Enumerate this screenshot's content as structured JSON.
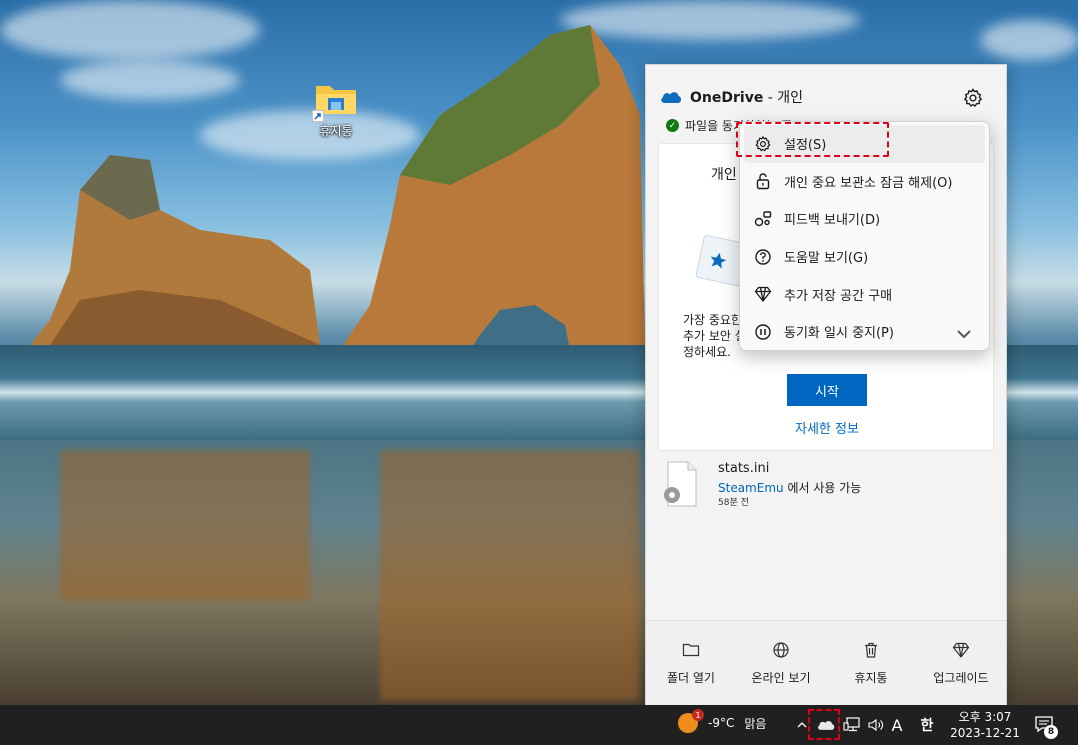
{
  "desktop": {
    "icons": [
      {
        "label": "휴지통",
        "icon": "folder-icon"
      }
    ]
  },
  "onedrive": {
    "title": "OneDrive",
    "title_suffix": " - 개인",
    "sync_status": "파일을 동기화하는 중",
    "card": {
      "title": "개인",
      "description": "가장 중요한 추가 보안 설정하세요.",
      "start_button": "시작",
      "more_link": "자세한 정보"
    },
    "file": {
      "name": "stats.ini",
      "location_link": "SteamEmu",
      "location_suffix": " 에서 사용 가능",
      "time": "58분 전"
    },
    "footer": [
      {
        "label": "폴더 열기",
        "icon": "folder-icon"
      },
      {
        "label": "온라인 보기",
        "icon": "globe-icon"
      },
      {
        "label": "휴지통",
        "icon": "trash-icon"
      },
      {
        "label": "업그레이드",
        "icon": "diamond-icon"
      }
    ]
  },
  "menu": {
    "items": [
      {
        "label": "설정(S)",
        "icon": "gear-icon"
      },
      {
        "label": "개인 중요 보관소 잠금 해제(O)",
        "icon": "unlock-icon"
      },
      {
        "label": "피드백 보내기(D)",
        "icon": "feedback-icon"
      },
      {
        "label": "도움말 보기(G)",
        "icon": "help-icon"
      },
      {
        "label": "추가 저장 공간 구매",
        "icon": "diamond-icon"
      },
      {
        "label": "동기화 일시 중지(P)",
        "icon": "pause-icon"
      }
    ]
  },
  "taskbar": {
    "weather_temp": "-9°C",
    "weather_desc": "맑음",
    "weather_badge": "1",
    "ime_letter": "A",
    "ime_lang": "한",
    "time": "오후 3:07",
    "date": "2023-12-21",
    "notification_count": "8"
  },
  "colors": {
    "accent": "#0067c0",
    "highlight_border": "#e0001a",
    "taskbar_bg": "#202020"
  }
}
